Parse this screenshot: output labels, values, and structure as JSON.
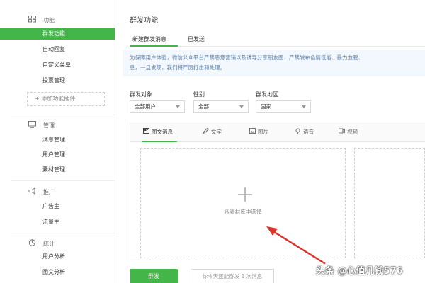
{
  "sidebar": {
    "sections": [
      {
        "label": "功能",
        "icon": "grid-icon"
      },
      {
        "label": "管理",
        "icon": "monitor-icon"
      },
      {
        "label": "推广",
        "icon": "megaphone-icon"
      },
      {
        "label": "统计",
        "icon": "chart-icon"
      }
    ],
    "items": [
      {
        "label": "群发功能"
      },
      {
        "label": "自动回复"
      },
      {
        "label": "自定义菜单"
      },
      {
        "label": "投票管理"
      },
      {
        "label": "消息管理"
      },
      {
        "label": "用户管理"
      },
      {
        "label": "素材管理"
      },
      {
        "label": "广告主"
      },
      {
        "label": "流量主"
      },
      {
        "label": "用户分析"
      },
      {
        "label": "图文分析"
      }
    ],
    "add_plugin": "+ 添加功能插件"
  },
  "main": {
    "title": "群发功能",
    "tabs": [
      {
        "label": "新建群发消息"
      },
      {
        "label": "已发送"
      }
    ],
    "notice": [
      "为保障用户体验，微信公众平台严禁恶意营销以及诱导分享朋友圈，严禁发布色情低俗、暴力血腥、",
      "息，一旦发现，我们将严厉打击和处理。"
    ],
    "filters": {
      "target": {
        "label": "群发对象",
        "value": "全部用户"
      },
      "gender": {
        "label": "性别",
        "value": "全部"
      },
      "region": {
        "label": "群发地区",
        "value": "国家"
      }
    },
    "toolbar": [
      {
        "label": "图文消息",
        "icon": "news-icon"
      },
      {
        "label": "文字",
        "icon": "pen-icon"
      },
      {
        "label": "图片",
        "icon": "image-icon"
      },
      {
        "label": "语音",
        "icon": "voice-icon"
      },
      {
        "label": "视频",
        "icon": "video-icon"
      }
    ],
    "pick_text": "从素材库中选择",
    "send_label": "群发",
    "quota_text": "你今天还能群发 1 次消息"
  },
  "watermark": "头条 @心值几钱576",
  "colors": {
    "accent": "#44b549",
    "notice_bg": "#f2f8fd",
    "arrow": "#d9342b"
  }
}
